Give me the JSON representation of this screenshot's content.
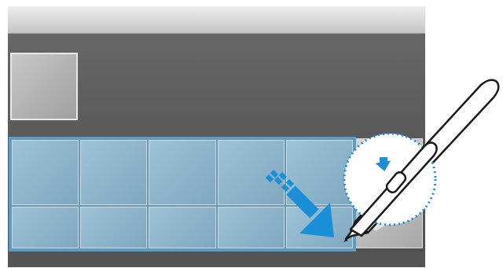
{
  "screen": {
    "title_bar": "",
    "grid_columns": 5,
    "grid_rows": 2
  },
  "icons": {
    "arrow": "selection-arrow-icon",
    "pen": "s-pen-icon",
    "button": "pen-button-icon"
  },
  "colors": {
    "selection_border": "#4aa3d8",
    "arrow_blue": "#1a8fd8",
    "tile_blue": "#8fb6cc"
  }
}
